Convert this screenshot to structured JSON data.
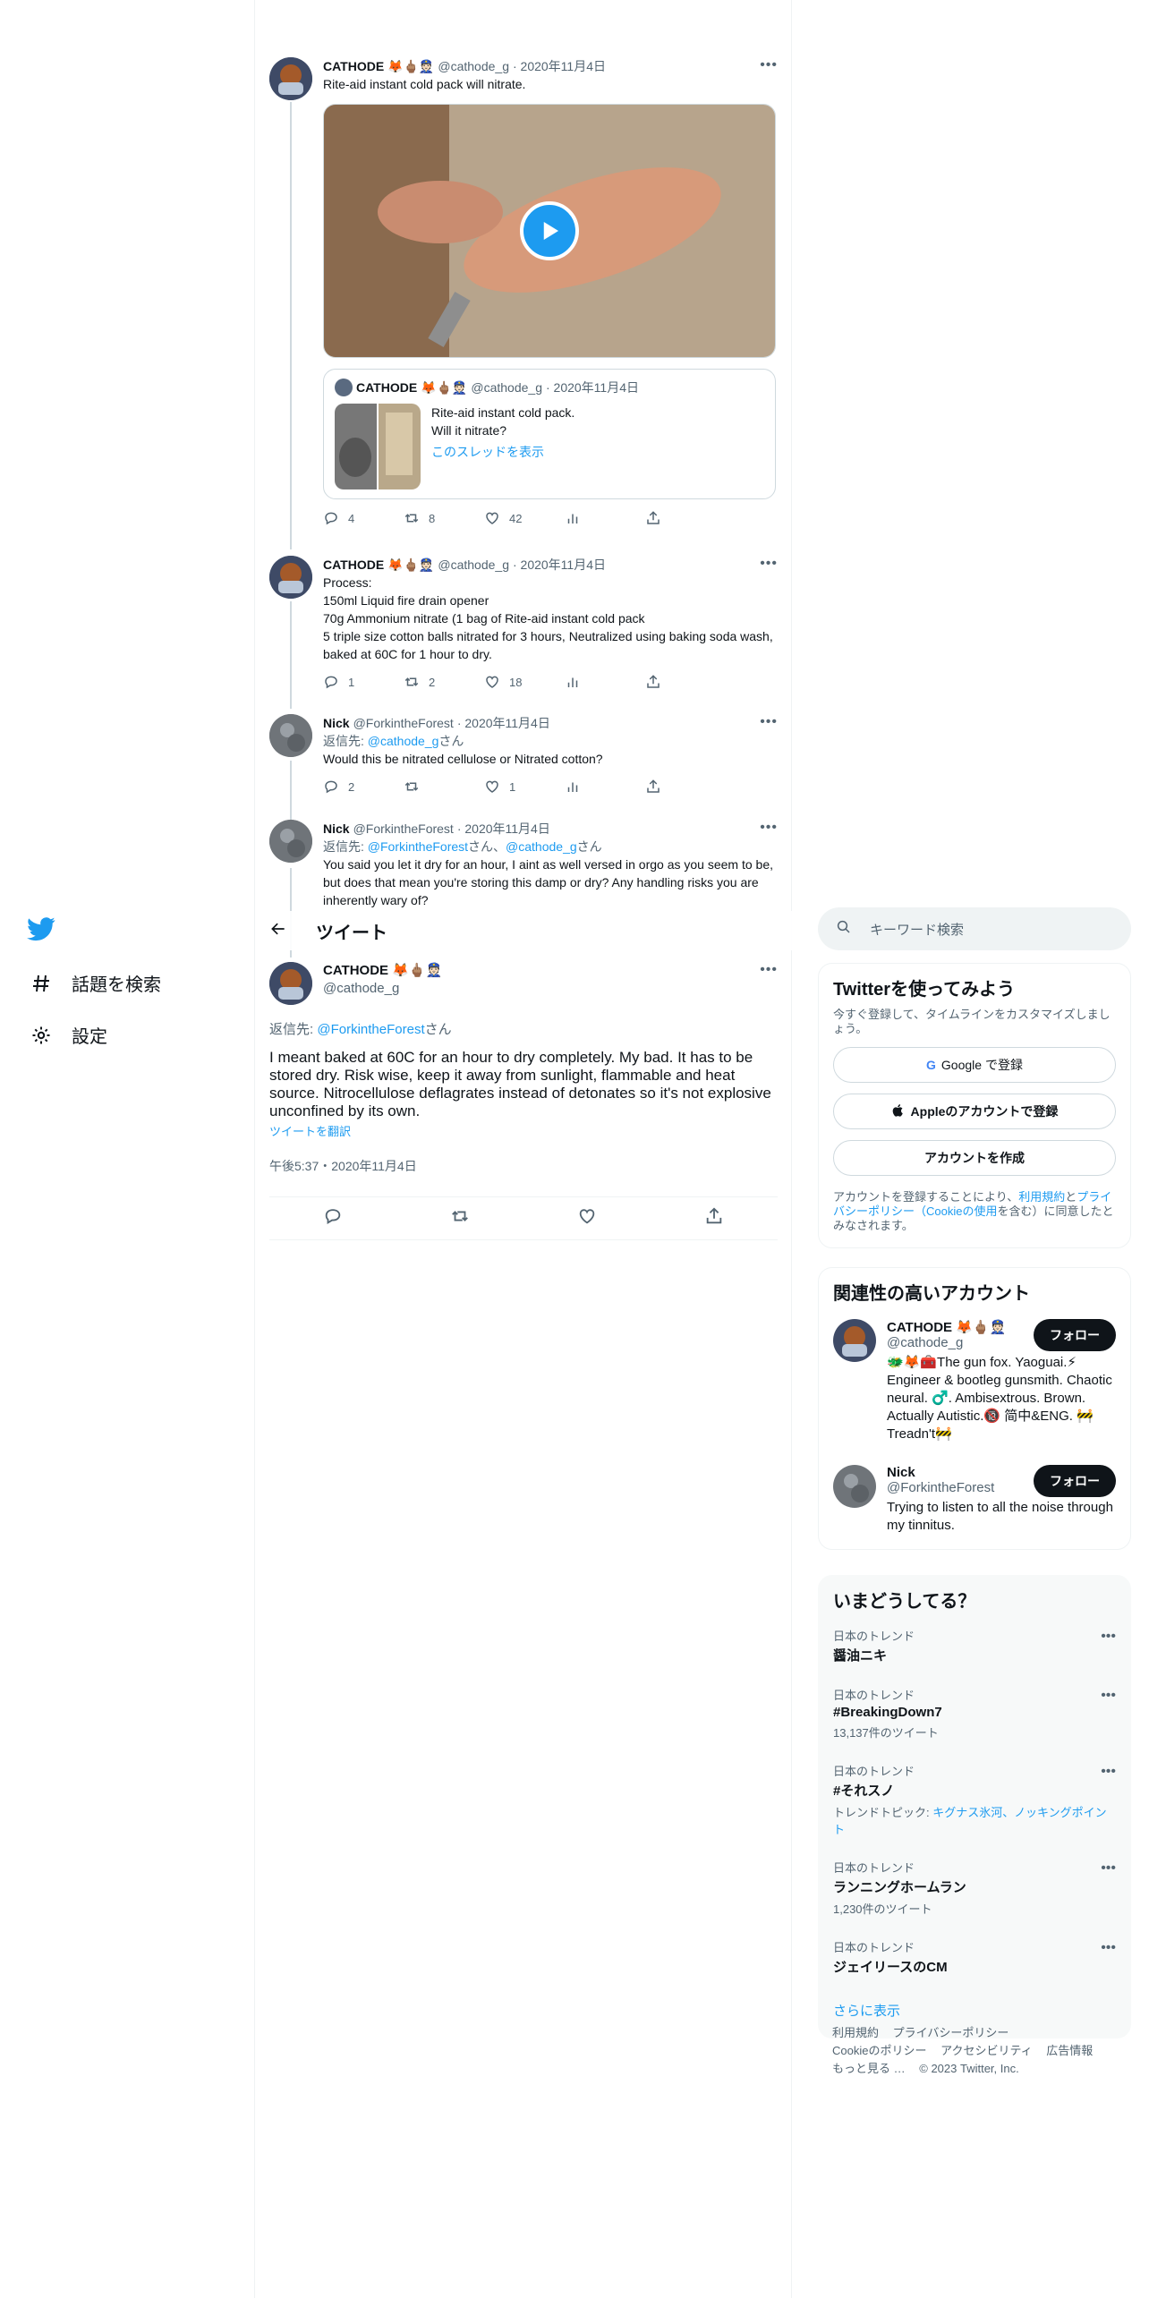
{
  "nav": {
    "explore_label": "話題を検索",
    "settings_label": "設定"
  },
  "header": {
    "title": "ツイート"
  },
  "thread": [
    {
      "name": "CATHODE 🦊🖕🏽👮🏻",
      "handle": "@cathode_g",
      "date": "· 2020年11月4日",
      "text": "Rite-aid instant cold pack will nitrate.",
      "replies": "4",
      "retweets": "8",
      "likes": "42"
    },
    {
      "name": "CATHODE 🦊🖕🏽👮🏻",
      "handle": "@cathode_g",
      "date": "· 2020年11月4日",
      "text_lines": [
        "Process:",
        "150ml Liquid fire drain opener",
        "70g Ammonium nitrate (1 bag of Rite-aid instant cold pack",
        "5 triple size cotton balls nitrated for 3 hours, Neutralized using baking soda wash, baked at 60C for 1 hour to dry."
      ],
      "replies": "1",
      "retweets": "2",
      "likes": "18"
    },
    {
      "name": "Nick",
      "handle": "@ForkintheForest",
      "date": "· 2020年11月4日",
      "reply_prefix": "返信先: ",
      "reply_to": "@cathode_g",
      "reply_suffix": "さん",
      "text": "Would this be nitrated cellulose or Nitrated cotton?",
      "replies": "2",
      "retweets": "",
      "likes": "1"
    },
    {
      "name": "Nick",
      "handle": "@ForkintheForest",
      "date": "· 2020年11月4日",
      "reply_prefix": "返信先: ",
      "reply_to_1": "@ForkintheForest",
      "reply_mid": "さん、",
      "reply_to_2": "@cathode_g",
      "reply_suffix": "さん",
      "text": "You said you let it dry for an hour, I aint as well versed in orgo as you seem to be, but does that mean you're storing this damp or dry? Any handling risks you are inherently wary of?"
    }
  ],
  "quote": {
    "name": "CATHODE 🦊🖕🏽👮🏻",
    "handle": "@cathode_g",
    "date": "· 2020年11月4日",
    "line1": "Rite-aid instant cold pack.",
    "line2": "Will it nitrate?",
    "show_thread": "このスレッドを表示"
  },
  "focus": {
    "name": "CATHODE 🦊🖕🏽👮🏻",
    "handle": "@cathode_g",
    "reply_prefix": "返信先: ",
    "reply_to": "@ForkintheForest",
    "reply_suffix": "さん",
    "text": "I meant baked at 60C for an hour to dry completely. My bad. It has to be stored dry. Risk wise, keep it away from sunlight, flammable and heat source. Nitrocellulose deflagrates instead of detonates so it's not explosive unconfined by its own.",
    "translate": "ツイートを翻訳",
    "timestamp": "午後5:37・2020年11月4日"
  },
  "search": {
    "placeholder": "キーワード検索"
  },
  "signup": {
    "title": "Twitterを使ってみよう",
    "subtitle": "今すぐ登録して、タイムラインをカスタマイズしましょう。",
    "google": "Google で登録",
    "apple": "Appleのアカウントで登録",
    "create": "アカウントを作成",
    "legal_1": "アカウントを登録することにより、",
    "terms": "利用規約",
    "legal_2": "と",
    "privacy": "プライバシーポリシー（Cookieの使用",
    "legal_3": "を含む）に同意したとみなされます。"
  },
  "related": {
    "title": "関連性の高いアカウント",
    "follow_label": "フォロー",
    "accounts": [
      {
        "name": "CATHODE 🦊🖕🏽👮🏻",
        "handle": "@cathode_g",
        "bio": "🐲🦊🧰The gun fox. Yaoguai.⚡ Engineer & bootleg gunsmith. Chaotic neural. ♂️. Ambisextrous. Brown. Actually Autistic.🔞 简中&ENG. 🚧Treadn't🚧"
      },
      {
        "name": "Nick",
        "handle": "@ForkintheForest",
        "bio": "Trying to listen to all the noise through my tinnitus."
      }
    ]
  },
  "trends": {
    "title": "いまどうしてる？",
    "items": [
      {
        "context": "日本のトレンド",
        "name": "醤油ニキ",
        "meta": ""
      },
      {
        "context": "日本のトレンド",
        "name": "#BreakingDown7",
        "meta": "13,137件のツイート"
      },
      {
        "context": "日本のトレンド",
        "name": "#それスノ",
        "meta_prefix": "トレンドトピック: ",
        "meta_link": "キグナス氷河、ノッキングポイント"
      },
      {
        "context": "日本のトレンド",
        "name": "ランニングホームラン",
        "meta": "1,230件のツイート"
      },
      {
        "context": "日本のトレンド",
        "name": "ジェイリースのCM",
        "meta": ""
      }
    ],
    "show_more": "さらに表示"
  },
  "footer": {
    "terms": "利用規約",
    "privacy": "プライバシーポリシー",
    "cookies": "Cookieのポリシー",
    "accessibility": "アクセシビリティ",
    "ads": "広告情報",
    "more": "もっと見る …",
    "copyright": "© 2023 Twitter, Inc."
  },
  "colors": {
    "accent": "#1d9bf0",
    "text": "#0f1419",
    "muted": "#536471"
  }
}
